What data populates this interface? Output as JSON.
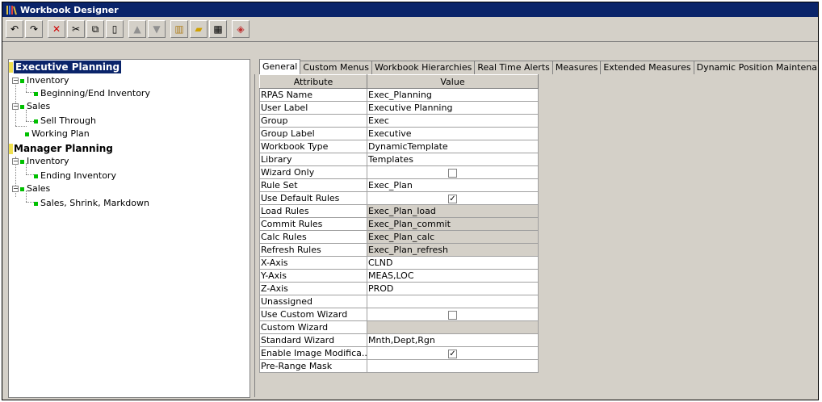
{
  "window": {
    "title": "Workbook Designer"
  },
  "toolbar": {
    "buttons": [
      {
        "name": "undo-icon",
        "glyph": "↶"
      },
      {
        "name": "redo-icon",
        "glyph": "↷"
      },
      {
        "name": "delete-icon",
        "glyph": "✕"
      },
      {
        "name": "cut-icon",
        "glyph": "✂"
      },
      {
        "name": "copy-icon",
        "glyph": "⧉"
      },
      {
        "name": "paste-icon",
        "glyph": "▯"
      },
      {
        "name": "move-up-icon",
        "glyph": "▲"
      },
      {
        "name": "move-down-icon",
        "glyph": "▼"
      },
      {
        "name": "library-icon",
        "glyph": "▥"
      },
      {
        "name": "open-folder-icon",
        "glyph": "▰"
      },
      {
        "name": "grid-icon",
        "glyph": "▦"
      },
      {
        "name": "rpas-icon",
        "glyph": "◈"
      }
    ]
  },
  "tree": {
    "executive_planning": "Executive Planning",
    "exec_inventory": "Inventory",
    "beginning_end_inventory": "Beginning/End Inventory",
    "exec_sales": "Sales",
    "sell_through": "Sell Through",
    "working_plan": "Working Plan",
    "manager_planning": "Manager Planning",
    "mgr_inventory": "Inventory",
    "ending_inventory": "Ending Inventory",
    "mgr_sales": "Sales",
    "sales_shrink_markdown": "Sales, Shrink, Markdown"
  },
  "tabs": [
    "General",
    "Custom Menus",
    "Workbook Hierarchies",
    "Real Time Alerts",
    "Measures",
    "Extended Measures",
    "Dynamic Position Maintenance"
  ],
  "grid": {
    "headers": [
      "Attribute",
      "Value"
    ],
    "rows": [
      {
        "attr": "RPAS Name",
        "value": "Exec_Planning",
        "type": "text"
      },
      {
        "attr": "User Label",
        "value": "Executive Planning",
        "type": "text"
      },
      {
        "attr": "Group",
        "value": "Exec",
        "type": "text"
      },
      {
        "attr": "Group Label",
        "value": "Executive",
        "type": "text"
      },
      {
        "attr": "Workbook Type",
        "value": "DynamicTemplate",
        "type": "text"
      },
      {
        "attr": "Library",
        "value": "Templates",
        "type": "text"
      },
      {
        "attr": "Wizard Only",
        "value": "",
        "type": "checkbox",
        "checked": false
      },
      {
        "attr": "Rule Set",
        "value": "Exec_Plan",
        "type": "text"
      },
      {
        "attr": "Use Default Rules",
        "value": "",
        "type": "checkbox",
        "checked": true
      },
      {
        "attr": "Load Rules",
        "value": "Exec_Plan_load",
        "type": "text",
        "gray": true
      },
      {
        "attr": "Commit Rules",
        "value": "Exec_Plan_commit",
        "type": "text",
        "gray": true
      },
      {
        "attr": "Calc Rules",
        "value": "Exec_Plan_calc",
        "type": "text",
        "gray": true
      },
      {
        "attr": "Refresh Rules",
        "value": "Exec_Plan_refresh",
        "type": "text",
        "gray": true
      },
      {
        "attr": "X-Axis",
        "value": "CLND",
        "type": "text"
      },
      {
        "attr": "Y-Axis",
        "value": "MEAS,LOC",
        "type": "text"
      },
      {
        "attr": "Z-Axis",
        "value": "PROD",
        "type": "text"
      },
      {
        "attr": "Unassigned",
        "value": "",
        "type": "text"
      },
      {
        "attr": "Use Custom Wizard",
        "value": "",
        "type": "checkbox",
        "checked": false
      },
      {
        "attr": "Custom Wizard",
        "value": "",
        "type": "text",
        "gray": true
      },
      {
        "attr": "Standard Wizard",
        "value": "Mnth,Dept,Rgn",
        "type": "text"
      },
      {
        "attr": "Enable Image Modifica...",
        "value": "",
        "type": "checkbox",
        "checked": true
      },
      {
        "attr": "Pre-Range Mask",
        "value": "",
        "type": "text"
      }
    ]
  }
}
